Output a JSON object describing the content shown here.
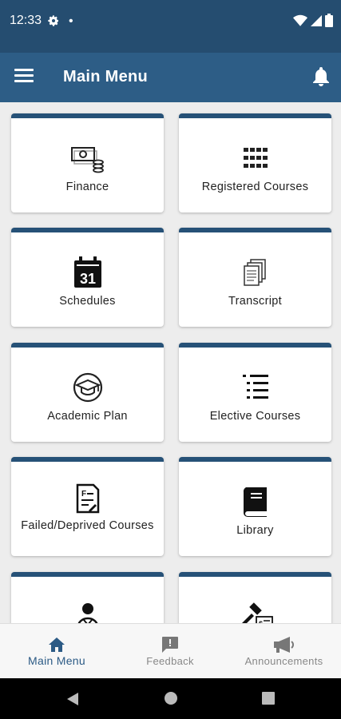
{
  "status": {
    "time": "12:33"
  },
  "header": {
    "title": "Main Menu"
  },
  "cards": [
    {
      "label": "Finance",
      "icon": "money-icon"
    },
    {
      "label": "Registered Courses",
      "icon": "grid-icon"
    },
    {
      "label": "Schedules",
      "icon": "calendar-icon",
      "date": "31"
    },
    {
      "label": "Transcript",
      "icon": "documents-icon"
    },
    {
      "label": "Academic Plan",
      "icon": "graduation-cap-icon"
    },
    {
      "label": "Elective Courses",
      "icon": "list-icon"
    },
    {
      "label": "Failed/Deprived Courses",
      "icon": "failed-doc-icon"
    },
    {
      "label": "Library",
      "icon": "book-icon"
    },
    {
      "label": "",
      "icon": "person-icon"
    },
    {
      "label": "",
      "icon": "gavel-icon"
    }
  ],
  "bottom_nav": [
    {
      "label": "Main Menu",
      "icon": "home-icon",
      "active": true
    },
    {
      "label": "Feedback",
      "icon": "feedback-icon",
      "active": false
    },
    {
      "label": "Announcements",
      "icon": "megaphone-icon",
      "active": false
    }
  ],
  "colors": {
    "primary": "#2d5d86",
    "status_bar": "#254d70",
    "card_accent": "#265177"
  }
}
